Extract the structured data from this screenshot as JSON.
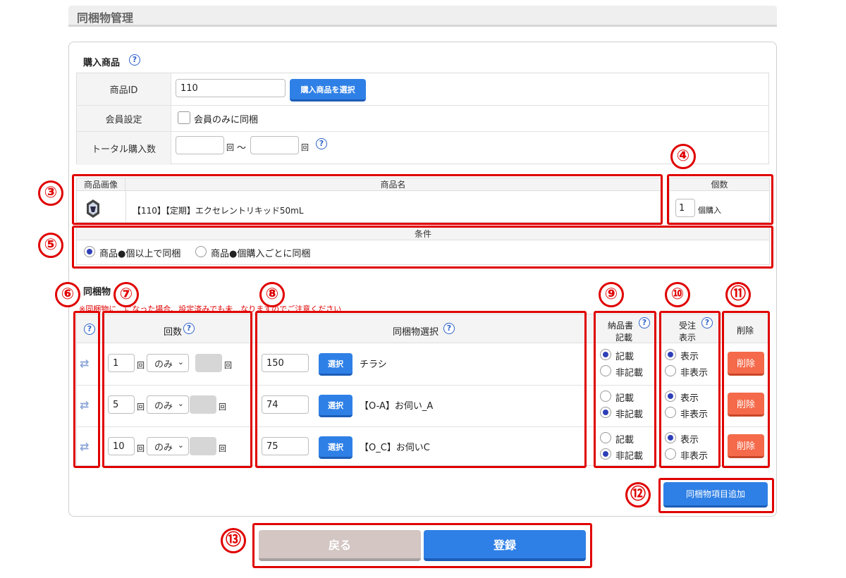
{
  "page_title": "同梱物管理",
  "purchase": {
    "section_title": "購入商品",
    "product_id_label": "商品ID",
    "product_id_value": "110",
    "select_product_button": "購入商品を選択",
    "member_label": "会員設定",
    "member_checkbox_label": "会員のみに同梱",
    "total_label": "トータル購入数",
    "unit": "回",
    "tilde": "～"
  },
  "product_table": {
    "col_image": "商品画像",
    "col_name": "商品名",
    "product_name": "【110】【定期】エクセレントリキッド50mL",
    "col_qty": "個数",
    "qty_value": "1",
    "qty_suffix": "個購入"
  },
  "condition": {
    "header": "条件",
    "option1": "商品●個以上で同梱",
    "option2": "商品●個購入ごとに同梱",
    "selected": "option1"
  },
  "bundle": {
    "section_title": "同梱物",
    "note": "※同梱物に…になった場合、設定済みでも未…なりますのでご注意ください",
    "col_help": "?",
    "col_count": "回数",
    "col_select": "同梱物選択",
    "col_invoice": "納品書\n記載",
    "col_invoice_l1": "納品書",
    "col_invoice_l2": "記載",
    "col_order_l1": "受注",
    "col_order_l2": "表示",
    "col_delete": "削除",
    "times_unit": "回",
    "select_button": "選択",
    "delete_button": "削除",
    "radio_invoice_on": "記載",
    "radio_invoice_off": "非記載",
    "radio_order_on": "表示",
    "radio_order_off": "非表示",
    "rows": [
      {
        "count": "1",
        "mode": "のみ",
        "item_id": "150",
        "item_name": "チラシ",
        "invoice": "記載",
        "order": "表示"
      },
      {
        "count": "5",
        "mode": "のみ",
        "item_id": "74",
        "item_name": "【O-A】お伺い_A",
        "invoice": "非記載",
        "order": "表示"
      },
      {
        "count": "10",
        "mode": "のみ",
        "item_id": "75",
        "item_name": "【O_C】お伺いC",
        "invoice": "非記載",
        "order": "表示"
      }
    ],
    "add_button": "同梱物項目追加"
  },
  "footer": {
    "back_button": "戻る",
    "register_button": "登録"
  },
  "annotations": [
    "③",
    "④",
    "⑤",
    "⑥",
    "⑦",
    "⑧",
    "⑨",
    "⑩",
    "⑪",
    "⑫",
    "⑬"
  ],
  "colors": {
    "accent_blue": "#2f80e6",
    "delete_red": "#f46a4a",
    "annotation_red": "#e00000",
    "back_button": "#d3c6c3"
  }
}
